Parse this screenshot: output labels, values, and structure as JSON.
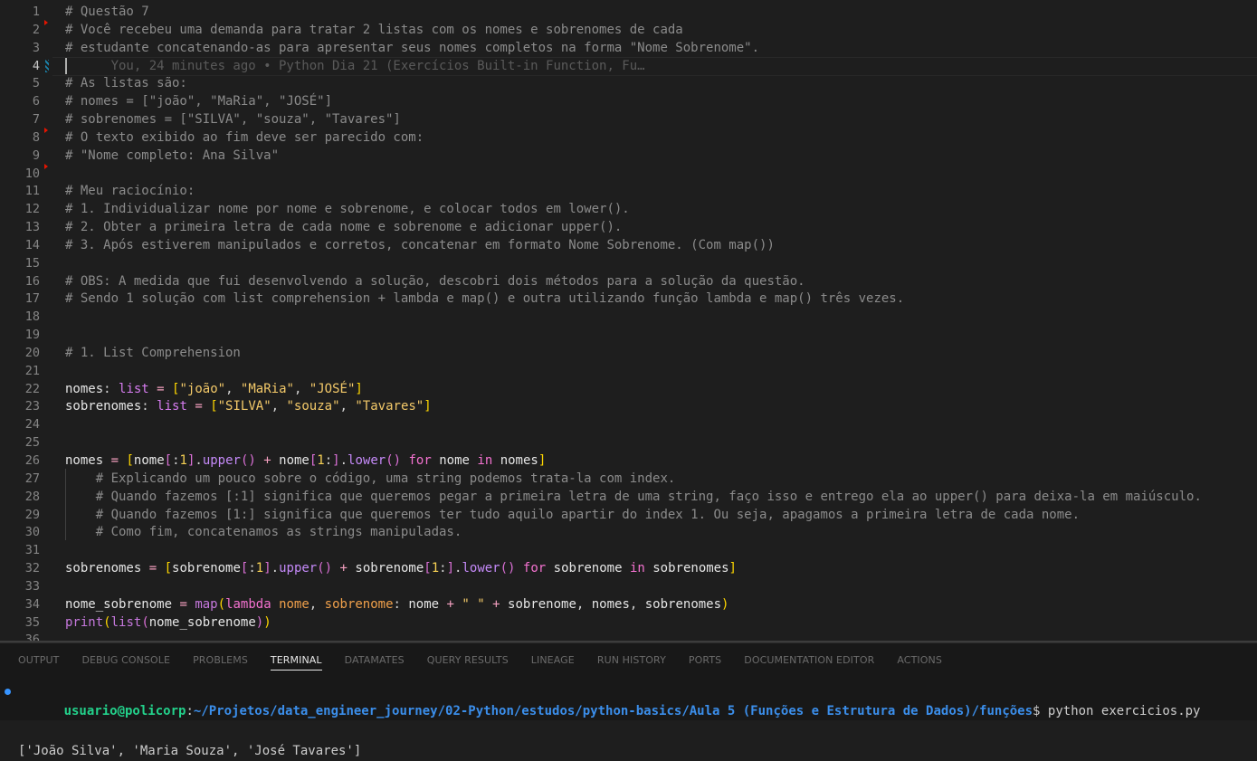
{
  "editor": {
    "top_cut_text": "# Questão 7 ... (linha anterior)",
    "active_line": 4,
    "blame_text": "You, 24 minutes ago • Python Dia 21 (Exercícios Built-in Function, Fu…",
    "lines": [
      {
        "n": "1",
        "tokens": [
          [
            "c",
            "# Questão 7"
          ]
        ]
      },
      {
        "n": "2",
        "tokens": [
          [
            "c",
            "# Você recebeu uma demanda para tratar 2 listas com os nomes e sobrenomes de cada"
          ]
        ]
      },
      {
        "n": "3",
        "tokens": [
          [
            "c",
            "# estudante concatenando-as para apresentar seus nomes completos na forma \"Nome Sobrenome\"."
          ]
        ]
      },
      {
        "n": "4",
        "tokens": [
          [
            "blame",
            "      You, 24 minutes ago • Python Dia 21 (Exercícios Built-in Function, Fu…"
          ]
        ]
      },
      {
        "n": "5",
        "tokens": [
          [
            "c",
            "# As listas são:"
          ]
        ]
      },
      {
        "n": "6",
        "tokens": [
          [
            "c",
            "# nomes = [\"joão\", \"MaRia\", \"JOSÉ\"]"
          ]
        ]
      },
      {
        "n": "7",
        "tokens": [
          [
            "c",
            "# sobrenomes = [\"SILVA\", \"souza\", \"Tavares\"]"
          ]
        ]
      },
      {
        "n": "8",
        "tokens": [
          [
            "c",
            "# O texto exibido ao fim deve ser parecido com:"
          ]
        ]
      },
      {
        "n": "9",
        "tokens": [
          [
            "c",
            "# \"Nome completo: Ana Silva\""
          ]
        ]
      },
      {
        "n": "10",
        "tokens": []
      },
      {
        "n": "11",
        "tokens": [
          [
            "c",
            "# Meu raciocínio:"
          ]
        ]
      },
      {
        "n": "12",
        "tokens": [
          [
            "c",
            "# 1. Individualizar nome por nome e sobrenome, e colocar todos em lower()."
          ]
        ]
      },
      {
        "n": "13",
        "tokens": [
          [
            "c",
            "# 2. Obter a primeira letra de cada nome e sobrenome e adicionar upper()."
          ]
        ]
      },
      {
        "n": "14",
        "tokens": [
          [
            "c",
            "# 3. Após estiverem manipulados e corretos, concatenar em formato Nome Sobrenome. (Com map())"
          ]
        ]
      },
      {
        "n": "15",
        "tokens": []
      },
      {
        "n": "16",
        "tokens": [
          [
            "c",
            "# OBS: A medida que fui desenvolvendo a solução, descobri dois métodos para a solução da questão."
          ]
        ]
      },
      {
        "n": "17",
        "tokens": [
          [
            "c",
            "# Sendo 1 solução com list comprehension + lambda e map() e outra utilizando função lambda e map() três vezes."
          ]
        ]
      },
      {
        "n": "18",
        "tokens": []
      },
      {
        "n": "19",
        "tokens": []
      },
      {
        "n": "20",
        "tokens": [
          [
            "c",
            "# 1. List Comprehension"
          ]
        ]
      },
      {
        "n": "21",
        "tokens": []
      },
      {
        "n": "22",
        "tokens": [
          [
            "v",
            "nomes"
          ],
          [
            "p",
            ": "
          ],
          [
            "ty",
            "list"
          ],
          [
            "p",
            " "
          ],
          [
            "o",
            "="
          ],
          [
            "p",
            " "
          ],
          [
            "b1",
            "["
          ],
          [
            "s",
            "\"joão\""
          ],
          [
            "p",
            ", "
          ],
          [
            "s",
            "\"MaRia\""
          ],
          [
            "p",
            ", "
          ],
          [
            "s",
            "\"JOSÉ\""
          ],
          [
            "b1",
            "]"
          ]
        ]
      },
      {
        "n": "23",
        "tokens": [
          [
            "v",
            "sobrenomes"
          ],
          [
            "p",
            ": "
          ],
          [
            "ty",
            "list"
          ],
          [
            "p",
            " "
          ],
          [
            "o",
            "="
          ],
          [
            "p",
            " "
          ],
          [
            "b1",
            "["
          ],
          [
            "s",
            "\"SILVA\""
          ],
          [
            "p",
            ", "
          ],
          [
            "s",
            "\"souza\""
          ],
          [
            "p",
            ", "
          ],
          [
            "s",
            "\"Tavares\""
          ],
          [
            "b1",
            "]"
          ]
        ]
      },
      {
        "n": "24",
        "tokens": []
      },
      {
        "n": "25",
        "tokens": []
      },
      {
        "n": "26",
        "tokens": [
          [
            "v",
            "nomes"
          ],
          [
            "p",
            " "
          ],
          [
            "o",
            "="
          ],
          [
            "p",
            " "
          ],
          [
            "b1",
            "["
          ],
          [
            "v",
            "nome"
          ],
          [
            "b2",
            "["
          ],
          [
            "p",
            ":"
          ],
          [
            "num",
            "1"
          ],
          [
            "b2",
            "]"
          ],
          [
            "p",
            "."
          ],
          [
            "f",
            "upper"
          ],
          [
            "b2",
            "()"
          ],
          [
            "p",
            " "
          ],
          [
            "o",
            "+"
          ],
          [
            "p",
            " "
          ],
          [
            "v",
            "nome"
          ],
          [
            "b2",
            "["
          ],
          [
            "num",
            "1"
          ],
          [
            "p",
            ":"
          ],
          [
            "b2",
            "]"
          ],
          [
            "p",
            "."
          ],
          [
            "f",
            "lower"
          ],
          [
            "b2",
            "()"
          ],
          [
            "p",
            " "
          ],
          [
            "k",
            "for"
          ],
          [
            "p",
            " "
          ],
          [
            "v",
            "nome"
          ],
          [
            "p",
            " "
          ],
          [
            "k",
            "in"
          ],
          [
            "p",
            " "
          ],
          [
            "v",
            "nomes"
          ],
          [
            "b1",
            "]"
          ]
        ]
      },
      {
        "n": "27",
        "tokens": [
          [
            "c",
            "    # Explicando um pouco sobre o código, uma string podemos trata-la com index."
          ]
        ]
      },
      {
        "n": "28",
        "tokens": [
          [
            "c",
            "    # Quando fazemos [:1] significa que queremos pegar a primeira letra de uma string, faço isso e entrego ela ao upper() para deixa-la em maiúsculo."
          ]
        ]
      },
      {
        "n": "29",
        "tokens": [
          [
            "c",
            "    # Quando fazemos [1:] significa que queremos ter tudo aquilo apartir do index 1. Ou seja, apagamos a primeira letra de cada nome."
          ]
        ]
      },
      {
        "n": "30",
        "tokens": [
          [
            "c",
            "    # Como fim, concatenamos as strings manipuladas."
          ]
        ]
      },
      {
        "n": "31",
        "tokens": []
      },
      {
        "n": "32",
        "tokens": [
          [
            "v",
            "sobrenomes"
          ],
          [
            "p",
            " "
          ],
          [
            "o",
            "="
          ],
          [
            "p",
            " "
          ],
          [
            "b1",
            "["
          ],
          [
            "v",
            "sobrenome"
          ],
          [
            "b2",
            "["
          ],
          [
            "p",
            ":"
          ],
          [
            "num",
            "1"
          ],
          [
            "b2",
            "]"
          ],
          [
            "p",
            "."
          ],
          [
            "f",
            "upper"
          ],
          [
            "b2",
            "()"
          ],
          [
            "p",
            " "
          ],
          [
            "o",
            "+"
          ],
          [
            "p",
            " "
          ],
          [
            "v",
            "sobrenome"
          ],
          [
            "b2",
            "["
          ],
          [
            "num",
            "1"
          ],
          [
            "p",
            ":"
          ],
          [
            "b2",
            "]"
          ],
          [
            "p",
            "."
          ],
          [
            "f",
            "lower"
          ],
          [
            "b2",
            "()"
          ],
          [
            "p",
            " "
          ],
          [
            "k",
            "for"
          ],
          [
            "p",
            " "
          ],
          [
            "v",
            "sobrenome"
          ],
          [
            "p",
            " "
          ],
          [
            "k",
            "in"
          ],
          [
            "p",
            " "
          ],
          [
            "v",
            "sobrenomes"
          ],
          [
            "b1",
            "]"
          ]
        ]
      },
      {
        "n": "33",
        "tokens": []
      },
      {
        "n": "34",
        "tokens": [
          [
            "v",
            "nome_sobrenome"
          ],
          [
            "p",
            " "
          ],
          [
            "o",
            "="
          ],
          [
            "p",
            " "
          ],
          [
            "f2",
            "map"
          ],
          [
            "b1",
            "("
          ],
          [
            "k",
            "lambda"
          ],
          [
            "p",
            " "
          ],
          [
            "pa",
            "nome"
          ],
          [
            "p",
            ", "
          ],
          [
            "pa",
            "sobrenome"
          ],
          [
            "p",
            ": "
          ],
          [
            "v",
            "nome"
          ],
          [
            "p",
            " "
          ],
          [
            "o",
            "+"
          ],
          [
            "p",
            " "
          ],
          [
            "s",
            "\" \""
          ],
          [
            "p",
            " "
          ],
          [
            "o",
            "+"
          ],
          [
            "p",
            " "
          ],
          [
            "v",
            "sobrenome"
          ],
          [
            "p",
            ", "
          ],
          [
            "v",
            "nomes"
          ],
          [
            "p",
            ", "
          ],
          [
            "v",
            "sobrenomes"
          ],
          [
            "b1",
            ")"
          ]
        ]
      },
      {
        "n": "35",
        "tokens": [
          [
            "f2",
            "print"
          ],
          [
            "b1",
            "("
          ],
          [
            "f2",
            "list"
          ],
          [
            "b2",
            "("
          ],
          [
            "v",
            "nome_sobrenome"
          ],
          [
            "b2",
            ")"
          ],
          [
            "b1",
            ")"
          ]
        ]
      },
      {
        "n": "36",
        "tokens": []
      }
    ]
  },
  "panel": {
    "tabs": [
      {
        "label": "OUTPUT",
        "active": false
      },
      {
        "label": "DEBUG CONSOLE",
        "active": false
      },
      {
        "label": "PROBLEMS",
        "active": false
      },
      {
        "label": "TERMINAL",
        "active": true
      },
      {
        "label": "DATAMATES",
        "active": false
      },
      {
        "label": "QUERY RESULTS",
        "active": false
      },
      {
        "label": "LINEAGE",
        "active": false
      },
      {
        "label": "RUN HISTORY",
        "active": false
      },
      {
        "label": "PORTS",
        "active": false
      },
      {
        "label": "DOCUMENTATION EDITOR",
        "active": false
      },
      {
        "label": "ACTIONS",
        "active": false
      }
    ]
  },
  "terminal": {
    "user_host": "usuario@policorp",
    "separator": ":",
    "path": "~/Projetos/data_engineer_journey/02-Python/estudos/python-basics/Aula 5 (Funções e Estrutura de Dados)/funções",
    "prompt_symbol": "$",
    "command": " python exercicios.py",
    "output": "['João Silva', 'Maria Souza', 'José Tavares']"
  },
  "colors": {
    "background": "#1e1e1e",
    "comment": "#8b8b8b",
    "string": "#f3c969",
    "keyword": "#f472d0",
    "terminal_user": "#23d18b",
    "terminal_path": "#3b8eea"
  }
}
